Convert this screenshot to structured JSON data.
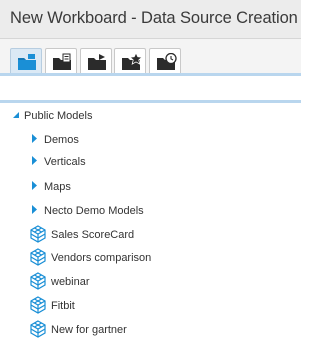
{
  "window": {
    "title": "New Workboard - Data Source Creation"
  },
  "tabs": [
    {
      "icon": "folder-models-icon",
      "active": true
    },
    {
      "icon": "folder-database-icon",
      "active": false
    },
    {
      "icon": "folder-shared-icon",
      "active": false
    },
    {
      "icon": "folder-favorites-icon",
      "active": false
    },
    {
      "icon": "folder-recent-icon",
      "active": false
    }
  ],
  "tree": {
    "root": {
      "label": "Public Models",
      "expanded": true
    },
    "folders": [
      {
        "label": "Demos"
      },
      {
        "label": "Verticals"
      },
      {
        "label": "Maps"
      },
      {
        "label": "Necto Demo Models"
      }
    ],
    "models": [
      {
        "label": "Sales ScoreCard"
      },
      {
        "label": "Vendors comparison"
      },
      {
        "label": "webinar"
      },
      {
        "label": "Fitbit"
      },
      {
        "label": "New for gartner"
      }
    ]
  },
  "colors": {
    "accent": "#1a8fd6",
    "rule": "#b9d6ee",
    "title_bg": "#ececec"
  }
}
